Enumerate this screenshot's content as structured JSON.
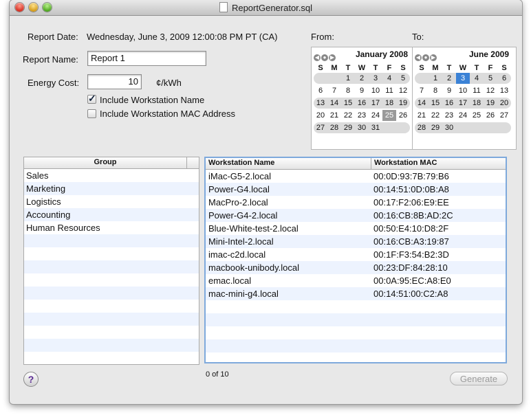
{
  "window": {
    "title": "ReportGenerator.sql"
  },
  "report": {
    "date_label": "Report Date:",
    "date_value": "Wednesday, June 3, 2009 12:00:08 PM PT (CA)",
    "name_label": "Report Name:",
    "name_value": "Report 1",
    "energy_label": "Energy Cost:",
    "energy_value": "10",
    "energy_unit": "¢/kWh",
    "include_name_label": "Include Workstation Name",
    "include_name_checked": true,
    "include_mac_label": "Include Workstation MAC Address",
    "include_mac_checked": false
  },
  "from": {
    "label": "From:",
    "month": "January 2008",
    "days": [
      "S",
      "M",
      "T",
      "W",
      "T",
      "F",
      "S"
    ],
    "weeks": [
      [
        "",
        "",
        "1",
        "2",
        "3",
        "4",
        "5"
      ],
      [
        "6",
        "7",
        "8",
        "9",
        "10",
        "11",
        "12"
      ],
      [
        "13",
        "14",
        "15",
        "16",
        "17",
        "18",
        "19"
      ],
      [
        "20",
        "21",
        "22",
        "23",
        "24",
        "25",
        "26"
      ],
      [
        "27",
        "28",
        "29",
        "30",
        "31",
        "",
        ""
      ]
    ],
    "selected": "25"
  },
  "to": {
    "label": "To:",
    "month": "June 2009",
    "days": [
      "S",
      "M",
      "T",
      "W",
      "T",
      "F",
      "S"
    ],
    "weeks": [
      [
        "",
        "1",
        "2",
        "3",
        "4",
        "5",
        "6"
      ],
      [
        "7",
        "8",
        "9",
        "10",
        "11",
        "12",
        "13"
      ],
      [
        "14",
        "15",
        "16",
        "17",
        "18",
        "19",
        "20"
      ],
      [
        "21",
        "22",
        "23",
        "24",
        "25",
        "26",
        "27"
      ],
      [
        "28",
        "29",
        "30",
        "",
        "",
        "",
        ""
      ]
    ],
    "selected": "3"
  },
  "groups": {
    "header": "Group",
    "items": [
      "Sales",
      "Marketing",
      "Logistics",
      "Accounting",
      "Human Resources"
    ]
  },
  "workstations": {
    "headers": {
      "name": "Workstation Name",
      "mac": "Workstation MAC"
    },
    "rows": [
      {
        "name": "iMac-G5-2.local",
        "mac": "00:0D:93:7B:79:B6"
      },
      {
        "name": "Power-G4.local",
        "mac": "00:14:51:0D:0B:A8"
      },
      {
        "name": "MacPro-2.local",
        "mac": "00:17:F2:06:E9:EE"
      },
      {
        "name": "Power-G4-2.local",
        "mac": "00:16:CB:8B:AD:2C"
      },
      {
        "name": "Blue-White-test-2.local",
        "mac": "00:50:E4:10:D8:2F"
      },
      {
        "name": "Mini-Intel-2.local",
        "mac": "00:16:CB:A3:19:87"
      },
      {
        "name": "imac-c2d.local",
        "mac": "00:1F:F3:54:B2:3D"
      },
      {
        "name": "macbook-unibody.local",
        "mac": "00:23:DF:84:28:10"
      },
      {
        "name": "emac.local",
        "mac": "00:0A:95:EC:A8:E0"
      },
      {
        "name": "mac-mini-g4.local",
        "mac": "00:14:51:00:C2:A8"
      }
    ],
    "count": "0 of 10"
  },
  "footer": {
    "help": "?",
    "generate": "Generate"
  },
  "colors": {
    "selection_blue": "#3b82d6",
    "stripe": "#edf3fe"
  }
}
